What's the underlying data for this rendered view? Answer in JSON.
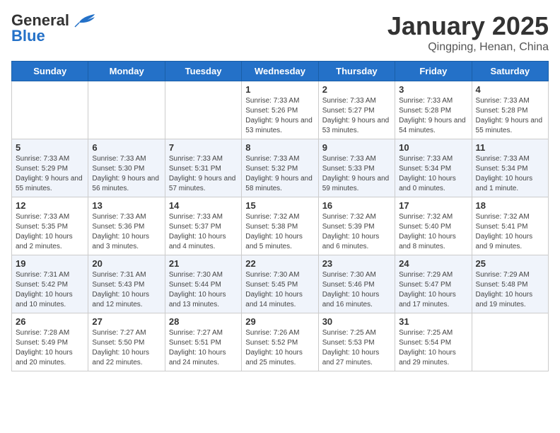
{
  "header": {
    "logo_general": "General",
    "logo_blue": "Blue",
    "month_title": "January 2025",
    "location": "Qingping, Henan, China"
  },
  "weekdays": [
    "Sunday",
    "Monday",
    "Tuesday",
    "Wednesday",
    "Thursday",
    "Friday",
    "Saturday"
  ],
  "weeks": [
    [
      {
        "day": "",
        "info": ""
      },
      {
        "day": "",
        "info": ""
      },
      {
        "day": "",
        "info": ""
      },
      {
        "day": "1",
        "info": "Sunrise: 7:33 AM\nSunset: 5:26 PM\nDaylight: 9 hours and 53 minutes."
      },
      {
        "day": "2",
        "info": "Sunrise: 7:33 AM\nSunset: 5:27 PM\nDaylight: 9 hours and 53 minutes."
      },
      {
        "day": "3",
        "info": "Sunrise: 7:33 AM\nSunset: 5:28 PM\nDaylight: 9 hours and 54 minutes."
      },
      {
        "day": "4",
        "info": "Sunrise: 7:33 AM\nSunset: 5:28 PM\nDaylight: 9 hours and 55 minutes."
      }
    ],
    [
      {
        "day": "5",
        "info": "Sunrise: 7:33 AM\nSunset: 5:29 PM\nDaylight: 9 hours and 55 minutes."
      },
      {
        "day": "6",
        "info": "Sunrise: 7:33 AM\nSunset: 5:30 PM\nDaylight: 9 hours and 56 minutes."
      },
      {
        "day": "7",
        "info": "Sunrise: 7:33 AM\nSunset: 5:31 PM\nDaylight: 9 hours and 57 minutes."
      },
      {
        "day": "8",
        "info": "Sunrise: 7:33 AM\nSunset: 5:32 PM\nDaylight: 9 hours and 58 minutes."
      },
      {
        "day": "9",
        "info": "Sunrise: 7:33 AM\nSunset: 5:33 PM\nDaylight: 9 hours and 59 minutes."
      },
      {
        "day": "10",
        "info": "Sunrise: 7:33 AM\nSunset: 5:34 PM\nDaylight: 10 hours and 0 minutes."
      },
      {
        "day": "11",
        "info": "Sunrise: 7:33 AM\nSunset: 5:34 PM\nDaylight: 10 hours and 1 minute."
      }
    ],
    [
      {
        "day": "12",
        "info": "Sunrise: 7:33 AM\nSunset: 5:35 PM\nDaylight: 10 hours and 2 minutes."
      },
      {
        "day": "13",
        "info": "Sunrise: 7:33 AM\nSunset: 5:36 PM\nDaylight: 10 hours and 3 minutes."
      },
      {
        "day": "14",
        "info": "Sunrise: 7:33 AM\nSunset: 5:37 PM\nDaylight: 10 hours and 4 minutes."
      },
      {
        "day": "15",
        "info": "Sunrise: 7:32 AM\nSunset: 5:38 PM\nDaylight: 10 hours and 5 minutes."
      },
      {
        "day": "16",
        "info": "Sunrise: 7:32 AM\nSunset: 5:39 PM\nDaylight: 10 hours and 6 minutes."
      },
      {
        "day": "17",
        "info": "Sunrise: 7:32 AM\nSunset: 5:40 PM\nDaylight: 10 hours and 8 minutes."
      },
      {
        "day": "18",
        "info": "Sunrise: 7:32 AM\nSunset: 5:41 PM\nDaylight: 10 hours and 9 minutes."
      }
    ],
    [
      {
        "day": "19",
        "info": "Sunrise: 7:31 AM\nSunset: 5:42 PM\nDaylight: 10 hours and 10 minutes."
      },
      {
        "day": "20",
        "info": "Sunrise: 7:31 AM\nSunset: 5:43 PM\nDaylight: 10 hours and 12 minutes."
      },
      {
        "day": "21",
        "info": "Sunrise: 7:30 AM\nSunset: 5:44 PM\nDaylight: 10 hours and 13 minutes."
      },
      {
        "day": "22",
        "info": "Sunrise: 7:30 AM\nSunset: 5:45 PM\nDaylight: 10 hours and 14 minutes."
      },
      {
        "day": "23",
        "info": "Sunrise: 7:30 AM\nSunset: 5:46 PM\nDaylight: 10 hours and 16 minutes."
      },
      {
        "day": "24",
        "info": "Sunrise: 7:29 AM\nSunset: 5:47 PM\nDaylight: 10 hours and 17 minutes."
      },
      {
        "day": "25",
        "info": "Sunrise: 7:29 AM\nSunset: 5:48 PM\nDaylight: 10 hours and 19 minutes."
      }
    ],
    [
      {
        "day": "26",
        "info": "Sunrise: 7:28 AM\nSunset: 5:49 PM\nDaylight: 10 hours and 20 minutes."
      },
      {
        "day": "27",
        "info": "Sunrise: 7:27 AM\nSunset: 5:50 PM\nDaylight: 10 hours and 22 minutes."
      },
      {
        "day": "28",
        "info": "Sunrise: 7:27 AM\nSunset: 5:51 PM\nDaylight: 10 hours and 24 minutes."
      },
      {
        "day": "29",
        "info": "Sunrise: 7:26 AM\nSunset: 5:52 PM\nDaylight: 10 hours and 25 minutes."
      },
      {
        "day": "30",
        "info": "Sunrise: 7:25 AM\nSunset: 5:53 PM\nDaylight: 10 hours and 27 minutes."
      },
      {
        "day": "31",
        "info": "Sunrise: 7:25 AM\nSunset: 5:54 PM\nDaylight: 10 hours and 29 minutes."
      },
      {
        "day": "",
        "info": ""
      }
    ]
  ]
}
